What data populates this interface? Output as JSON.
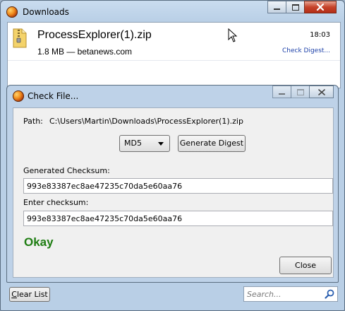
{
  "downloads_window": {
    "title": "Downloads",
    "item": {
      "filename": "ProcessExplorer(1).zip",
      "meta": "1.8 MB — betanews.com",
      "time": "18:03",
      "action_link": "Check Digest..."
    },
    "clear_list_prefix": "C",
    "clear_list_rest": "lear List",
    "search": {
      "placeholder": "Search...",
      "value": ""
    }
  },
  "check_file_dialog": {
    "title": "Check File...",
    "path_label": "Path:",
    "path_value": "C:\\Users\\Martin\\Downloads\\ProcessExplorer(1).zip",
    "algorithm": {
      "selected": "MD5"
    },
    "generate_button": "Generate Digest",
    "generated_label": "Generated Checksum:",
    "generated_value": "993e83387ec8ae47235c70da5e60aa76",
    "enter_label": "Enter checksum:",
    "enter_value": "993e83387ec8ae47235c70da5e60aa76",
    "result": "Okay",
    "close_button": "Close"
  },
  "colors": {
    "result_ok": "#1e7d12",
    "link": "#1b3fa8",
    "window_frame": "#b9cfe6"
  },
  "icons": [
    "firefox-icon",
    "zip-file-icon",
    "minimize-icon",
    "maximize-icon",
    "close-icon",
    "search-icon",
    "mouse-cursor-icon",
    "dropdown-arrow-icon"
  ]
}
